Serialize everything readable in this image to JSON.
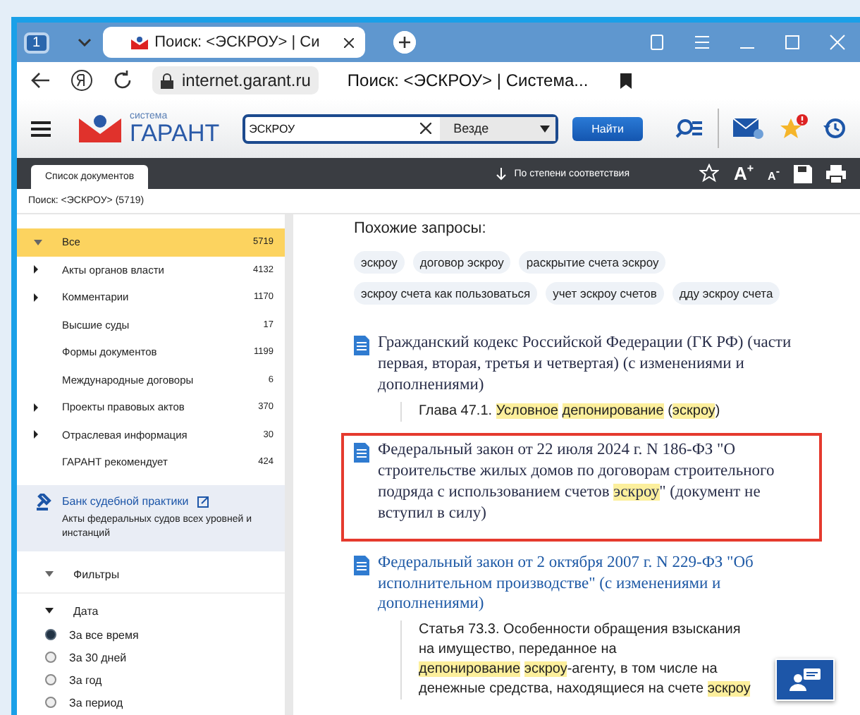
{
  "browser": {
    "tab_count": "1",
    "tab_title": "Поиск: <ЭСКРОУ> | Си",
    "url": "internet.garant.ru",
    "page_title": "Поиск: <ЭСКРОУ> | Система..."
  },
  "header": {
    "logo_small": "система",
    "logo_big": "ГАРАНТ",
    "search_value": "ЭСКРОУ",
    "scope": "Везде",
    "search_button": "Найти"
  },
  "toolbar": {
    "tab": "Список документов",
    "sort": "По степени соответствия",
    "font_up": "A$^{+}$",
    "font_down": "A$^{-}$"
  },
  "breadcrumb": "Поиск: <ЭСКРОУ> (5719)",
  "sidebar": {
    "items": [
      {
        "label": "Все",
        "count": "5719",
        "kind": "expanded",
        "selected": true
      },
      {
        "label": "Акты органов власти",
        "count": "4132",
        "kind": "collapsed",
        "selected": false
      },
      {
        "label": "Комментарии",
        "count": "1170",
        "kind": "collapsed",
        "selected": false
      },
      {
        "label": "Высшие суды",
        "count": "17",
        "kind": "leaf",
        "selected": false
      },
      {
        "label": "Формы документов",
        "count": "1199",
        "kind": "leaf",
        "selected": false
      },
      {
        "label": "Международные договоры",
        "count": "6",
        "kind": "leaf",
        "selected": false
      },
      {
        "label": "Проекты правовых актов",
        "count": "370",
        "kind": "collapsed",
        "selected": false
      },
      {
        "label": "Отраслевая информация",
        "count": "30",
        "kind": "collapsed",
        "selected": false
      },
      {
        "label": "ГАРАНТ рекомендует",
        "count": "424",
        "kind": "leaf",
        "selected": false
      }
    ],
    "bank": {
      "title": "Банк судебной практики",
      "description": "Акты федеральных судов всех уровней и инстанций"
    },
    "filters": "Фильтры",
    "date_label": "Дата",
    "date_options": [
      {
        "label": "За все время",
        "selected": true
      },
      {
        "label": "За 30 дней",
        "selected": false
      },
      {
        "label": "За год",
        "selected": false
      },
      {
        "label": "За период",
        "selected": false
      }
    ]
  },
  "similar": {
    "title": "Похожие запросы:",
    "chips": [
      "эскроу",
      "договор эскроу",
      "раскрытие счета эскроу",
      "эскроу счета как пользоваться",
      "учет эскроу счетов",
      "дду эскроу счета"
    ]
  },
  "results": [
    {
      "title": [
        {
          "text": "Гражданский кодекс Российской Федерации (ГК РФ) (части первая, вторая, третья и четвертая) (с изменениями и дополнениями)",
          "highlight": false
        }
      ],
      "link": false,
      "framed": false,
      "snippet": [
        {
          "text": "Глава 47.1. ",
          "highlight": false
        },
        {
          "text": "Условное",
          "highlight": true
        },
        {
          "text": "депонирование",
          "highlight": true
        },
        {
          "text": " (",
          "highlight": false
        },
        {
          "text": "эскроу",
          "highlight": true
        },
        {
          "text": ")",
          "highlight": false
        }
      ]
    },
    {
      "title": [
        {
          "text": "Федеральный закон от 22 июля 2024 г. N 186-ФЗ \"О строительстве жилых домов по договорам строительного подряда с использованием счетов ",
          "highlight": false
        },
        {
          "text": "эскроу",
          "highlight": true
        },
        {
          "text": "\" (документ не вступил в силу)",
          "highlight": false
        }
      ],
      "link": false,
      "framed": true
    },
    {
      "title": [
        {
          "text": "Федеральный закон от 2 октября 2007 г. N 229-ФЗ \"Об исполнительном производстве\" (с изменениями и дополнениями)",
          "highlight": false
        }
      ],
      "link": true,
      "framed": false,
      "snippet": [
        {
          "text": "Статья 73.3. Особенности обращения взыскания на имущество, переданное на ",
          "highlight": false
        },
        {
          "text": "депонирование",
          "highlight": true
        },
        {
          "text": "эскроу",
          "highlight": true
        },
        {
          "text": "-агенту, в том числе на денежные средства, находящиеся на счете ",
          "highlight": false
        },
        {
          "text": "эскроу",
          "highlight": true
        }
      ]
    }
  ]
}
